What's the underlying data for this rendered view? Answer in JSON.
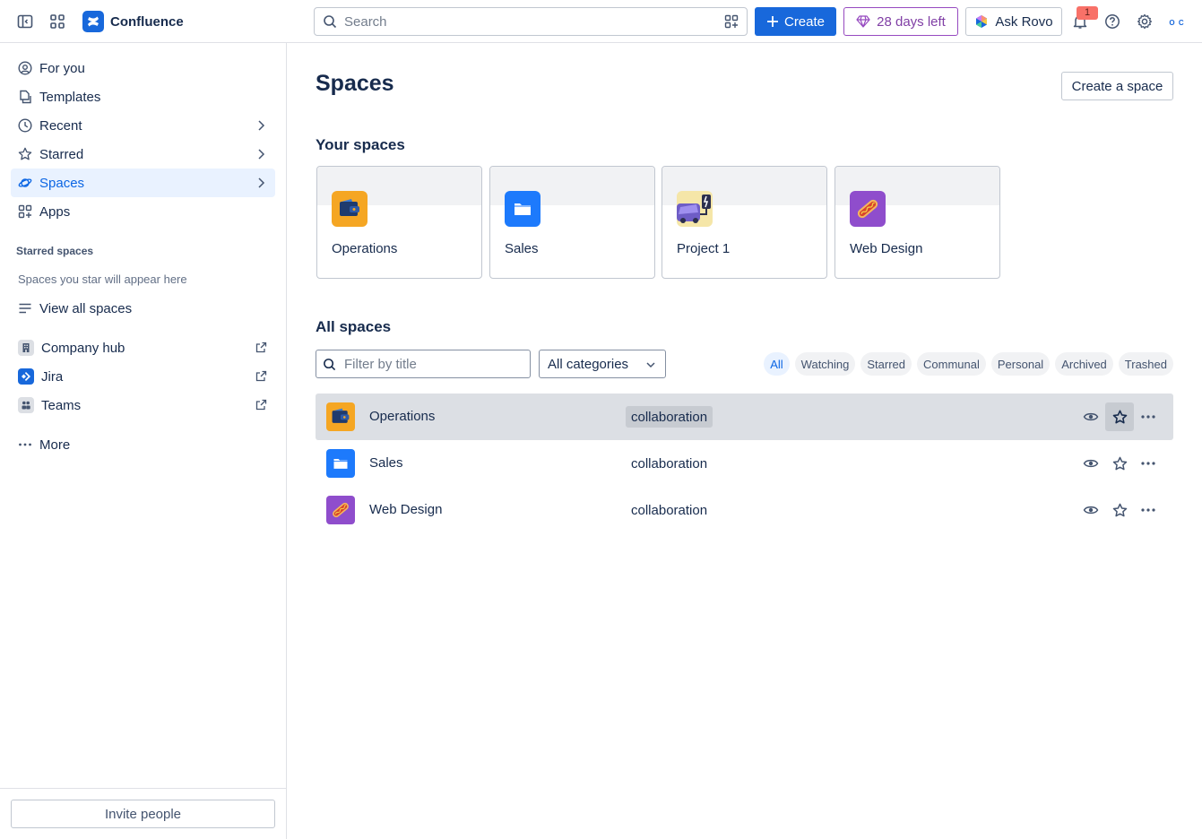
{
  "topbar": {
    "app_name": "Confluence",
    "search_placeholder": "Search",
    "create_label": "Create",
    "trial_label": "28 days left",
    "rovo_label": "Ask Rovo",
    "notification_count": "1",
    "avatar_text": "O C"
  },
  "sidebar": {
    "nav": [
      {
        "label": "For you"
      },
      {
        "label": "Templates"
      },
      {
        "label": "Recent"
      },
      {
        "label": "Starred"
      },
      {
        "label": "Spaces"
      },
      {
        "label": "Apps"
      }
    ],
    "starred_heading": "Starred spaces",
    "starred_empty": "Spaces you star will appear here",
    "view_all": "View all spaces",
    "apps": [
      {
        "label": "Company hub"
      },
      {
        "label": "Jira"
      },
      {
        "label": "Teams"
      }
    ],
    "more": "More",
    "invite": "Invite people"
  },
  "main": {
    "title": "Spaces",
    "create_space": "Create a space",
    "your_spaces_heading": "Your spaces",
    "your_spaces": [
      {
        "name": "Operations",
        "icon": "wallet-icon",
        "color": "#f5a623"
      },
      {
        "name": "Sales",
        "icon": "folder-icon",
        "color": "#1d7afc"
      },
      {
        "name": "Project 1",
        "icon": "car-charging-icon",
        "color": "#f5e6a8"
      },
      {
        "name": "Web Design",
        "icon": "hotdog-icon",
        "color": "#8f4dcc"
      }
    ],
    "all_spaces_heading": "All spaces",
    "filter_placeholder": "Filter by title",
    "category_selected": "All categories",
    "chips": [
      "All",
      "Watching",
      "Starred",
      "Communal",
      "Personal",
      "Archived",
      "Trashed"
    ],
    "rows": [
      {
        "name": "Operations",
        "category": "collaboration",
        "icon": "wallet-icon"
      },
      {
        "name": "Sales",
        "category": "collaboration",
        "icon": "folder-icon"
      },
      {
        "name": "Web Design",
        "category": "collaboration",
        "icon": "hotdog-icon"
      }
    ]
  },
  "colors": {
    "brand": "#1868db",
    "trial": "#964ac0",
    "selected_nav_bg": "#e9f2ff",
    "selected_nav_text": "#0c66e4"
  }
}
